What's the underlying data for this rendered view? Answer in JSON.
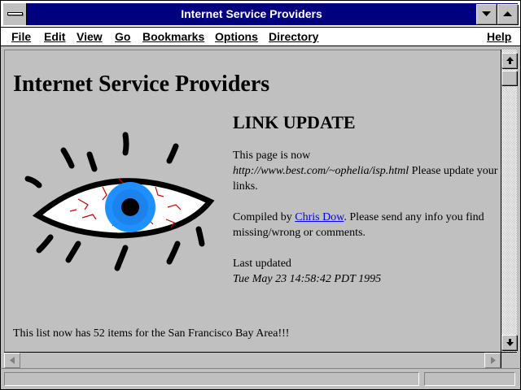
{
  "window": {
    "title": "Internet Service Providers"
  },
  "menu": {
    "file": "File",
    "edit": "Edit",
    "view": "View",
    "go": "Go",
    "bookmarks": "Bookmarks",
    "options": "Options",
    "directory": "Directory",
    "help": "Help"
  },
  "page": {
    "heading": "Internet Service Providers",
    "link_update_heading": "LINK UPDATE",
    "moved_intro": "This page is now",
    "new_url": "http://www.best.com/~ophelia/isp.html",
    "moved_tail": " Please update your links.",
    "compiled_by": "Compiled by ",
    "author_link": "Chris Dow",
    "compiled_tail": ". Please send any info you find missing/wrong or comments.",
    "last_updated_label": "Last updated",
    "last_updated_date": "Tue May 23 14:58:42 PDT 1995",
    "items_line": "This list now has 52 items for the San Francisco Bay Area!!!"
  },
  "status": {
    "text": ""
  },
  "icons": {
    "system_menu": "system-menu-icon",
    "minimize": "minimize-icon",
    "maximize": "maximize-icon",
    "scroll_up": "arrow-up-icon",
    "scroll_down": "arrow-down-icon",
    "scroll_left": "arrow-left-icon",
    "scroll_right": "arrow-right-icon",
    "eye_illustration": "eye-icon"
  },
  "colors": {
    "titlebar": "#000080",
    "link": "#0000ff",
    "background": "#c0c0c0",
    "iris": "#1e90ff",
    "veins": "#d00000"
  }
}
